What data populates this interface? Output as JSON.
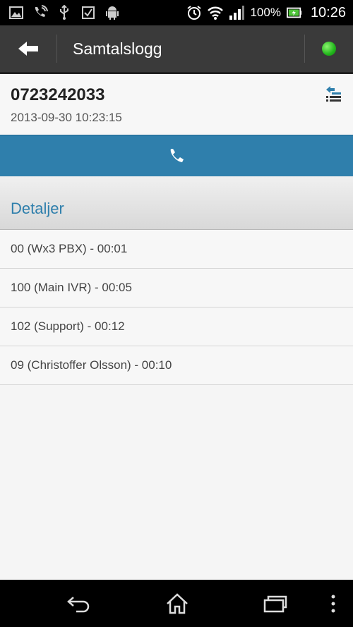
{
  "statusbar": {
    "battery_percent": "100%",
    "time": "10:26",
    "icons": [
      "image-icon",
      "call-wifi-icon",
      "usb-icon",
      "checkbox-icon",
      "android-icon",
      "alarm-icon",
      "wifi-icon",
      "signal-icon",
      "battery-icon"
    ]
  },
  "actionbar": {
    "title": "Samtalslogg",
    "status_color": "#21b61b"
  },
  "call": {
    "number": "0723242033",
    "datetime": "2013-09-30 10:23:15"
  },
  "section": {
    "title": "Detaljer"
  },
  "details": [
    "00 (Wx3 PBX) - 00:01",
    "100 (Main IVR) - 00:05",
    "102 (Support) - 00:12",
    "09 (Christoffer Olsson) - 00:10"
  ],
  "colors": {
    "accent": "#2f7fac",
    "actionbar": "#3a3a3a"
  }
}
